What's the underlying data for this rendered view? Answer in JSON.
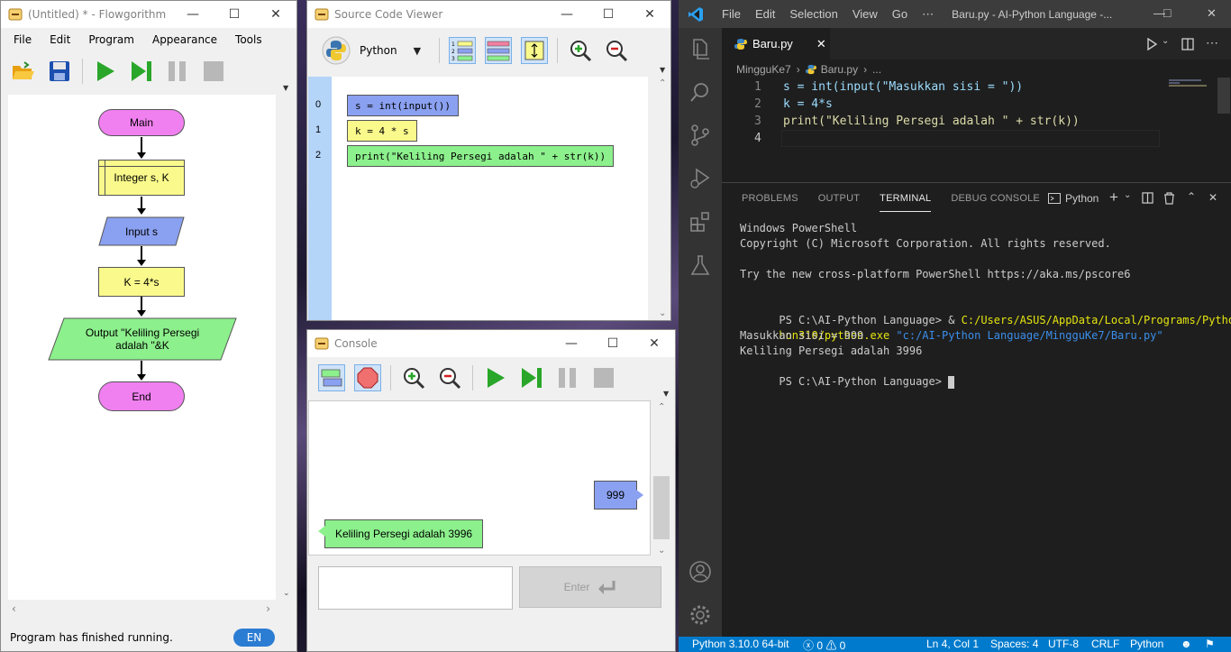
{
  "flowgorithm": {
    "title": "(Untitled) * - Flowgorithm",
    "menu": [
      "File",
      "Edit",
      "Program",
      "Appearance",
      "Tools"
    ],
    "shapes": {
      "main": "Main",
      "declare": "Integer s, K",
      "input": "Input s",
      "assign": "K = 4*s",
      "output_line1": "Output \"Keliling Persegi",
      "output_line2": "adalah \"&K",
      "end": "End"
    },
    "status": "Program has finished running.",
    "lang": "EN"
  },
  "source_viewer": {
    "title": "Source Code Viewer",
    "language": "Python",
    "lines": [
      {
        "no": "0",
        "code": "s = int(input())",
        "color": "#8aa0f0"
      },
      {
        "no": "1",
        "code": "k = 4 * s",
        "color": "#fafa8c"
      },
      {
        "no": "2",
        "code": "print(\"Keliling Persegi adalah \" + str(k))",
        "color": "#8cf08c"
      }
    ]
  },
  "console": {
    "title": "Console",
    "input_bubble": "999",
    "output_bubble": "Keliling Persegi adalah 3996",
    "enter_label": "Enter",
    "input_value": ""
  },
  "vscode": {
    "menu": [
      "File",
      "Edit",
      "Selection",
      "View",
      "Go",
      "⋯"
    ],
    "title": "Baru.py - AI-Python Language -...",
    "tab": "Baru.py",
    "breadcrumb_folder": "MingguKe7",
    "breadcrumb_file": "Baru.py",
    "breadcrumb_more": "...",
    "code": [
      {
        "no": "1",
        "text": "s = int(input(\"Masukkan sisi = \"))"
      },
      {
        "no": "2",
        "text": "k = 4*s"
      },
      {
        "no": "3",
        "text": "print(\"Keliling Persegi adalah \" + str(k))"
      },
      {
        "no": "4",
        "text": ""
      }
    ],
    "panel_tabs": [
      "PROBLEMS",
      "OUTPUT",
      "TERMINAL",
      "DEBUG CONSOLE"
    ],
    "terminal_profile": "Python",
    "terminal": {
      "l1": "Windows PowerShell",
      "l2": "Copyright (C) Microsoft Corporation. All rights reserved.",
      "l3": "Try the new cross-platform PowerShell https://aka.ms/pscore6",
      "l4_prompt": "PS C:\\AI-Python Language> & ",
      "l4_exe": "C:/Users/ASUS/AppData/Local/Programs/Python/Pyt",
      "l5_exe": "hon310/python.exe",
      "l5_arg": " \"c:/AI-Python Language/MingguKe7/Baru.py\"",
      "l6": "Masukkan sisi = 999",
      "l7": "Keliling Persegi adalah 3996",
      "l8": "PS C:\\AI-Python Language> "
    },
    "status": {
      "interpreter": "Python 3.10.0 64-bit",
      "problems": "ⓧ 0 ⚠ 0",
      "position": "Ln 4, Col 1",
      "spaces": "Spaces: 4",
      "encoding": "UTF-8",
      "eol": "CRLF",
      "language": "Python"
    }
  }
}
